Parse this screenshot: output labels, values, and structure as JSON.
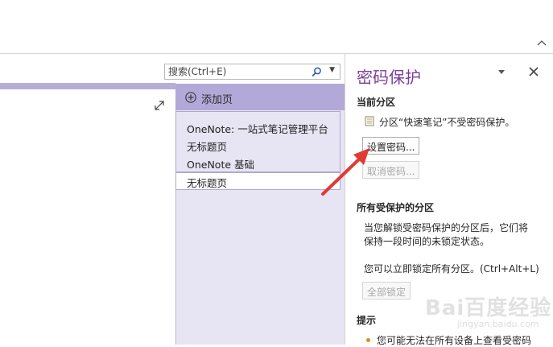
{
  "search": {
    "placeholder": "搜索(Ctrl+E)"
  },
  "pages": {
    "add_page_label": "添加页",
    "items": [
      {
        "label": "OneNote: 一站式笔记管理平台"
      },
      {
        "label": "无标题页"
      },
      {
        "label": "OneNote 基础"
      },
      {
        "label": "无标题页"
      }
    ]
  },
  "pane": {
    "title": "密码保护",
    "current_section": {
      "heading": "当前分区",
      "status": "分区“快速笔记”不受密码保护。",
      "set_password_button": "设置密码...",
      "remove_password_button": "取消密码..."
    },
    "all_protected": {
      "heading": "所有受保护的分区",
      "desc_line1": "当您解锁受密码保护的分区后，它们将",
      "desc_line2": "保持一段时间的未锁定状态。",
      "lock_hint": "您可以立即锁定所有分区。(Ctrl+Alt+L)",
      "lock_all_button": "全部锁定"
    },
    "tips": {
      "heading": "提示",
      "tip1": "您可能无法在所有设备上查看受密码"
    }
  },
  "watermark": {
    "main": "Bai百度经验",
    "sub": "jingyan.baidu.com"
  },
  "colors": {
    "accent_purple": "#7b3f9a",
    "page_tab_purple": "#b2a9d8",
    "arrow_red": "#e03a35"
  }
}
